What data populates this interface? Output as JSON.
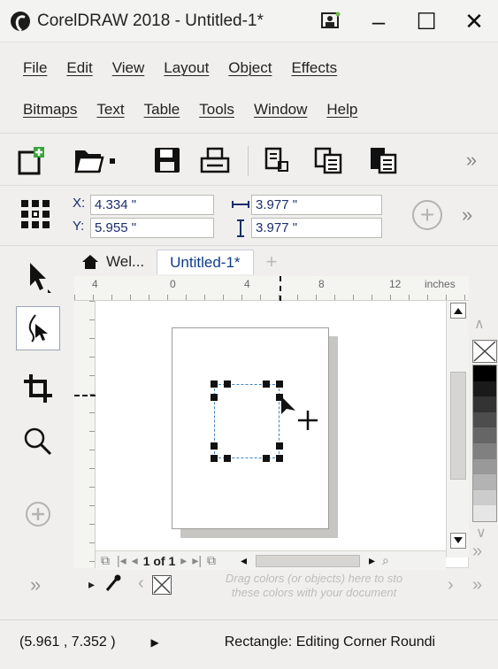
{
  "window": {
    "title": "CorelDRAW 2018 - Untitled-1*",
    "minimize": "‒",
    "maximize": "☐",
    "close": "✕"
  },
  "menu": {
    "row1": [
      "File",
      "Edit",
      "View",
      "Layout",
      "Object",
      "Effects"
    ],
    "row2": [
      "Bitmaps",
      "Text",
      "Table",
      "Tools",
      "Window",
      "Help"
    ]
  },
  "toolbar": {
    "overflow": "»"
  },
  "properties": {
    "x_label": "X:",
    "x_value": "4.334 \"",
    "y_label": "Y:",
    "y_value": "5.955 \"",
    "w_value": "3.977 \"",
    "h_value": "3.977 \"",
    "add": "+",
    "overflow": "»"
  },
  "tabs": {
    "welcome": "Wel...",
    "doc": "Untitled-1*",
    "add": "+"
  },
  "ruler": {
    "ticks": [
      "4",
      "0",
      "4",
      "8",
      "12"
    ],
    "unit": "inches"
  },
  "pager": {
    "label": "1 of 1"
  },
  "docpalette": {
    "hint_line1": "Drag colors (or objects) here to sto",
    "hint_line2": "these colors with your document"
  },
  "status": {
    "coords": "(5.961 , 7.352 )",
    "message": "Rectangle: Editing Corner Roundi"
  },
  "palette": {
    "colors": [
      "#000000",
      "#1a1a1a",
      "#333333",
      "#4d4d4d",
      "#666666",
      "#808080",
      "#999999",
      "#b3b3b3",
      "#cccccc",
      "#e6e6e6"
    ]
  },
  "colors": {
    "selection": "#3d82c4",
    "accent": "#0e3c8c"
  }
}
